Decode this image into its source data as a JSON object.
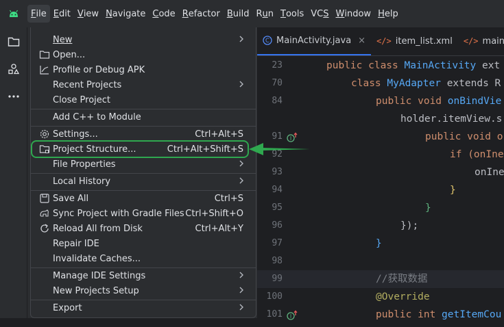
{
  "menubar": {
    "items": [
      "File",
      "Edit",
      "View",
      "Navigate",
      "Code",
      "Refactor",
      "Build",
      "Run",
      "Tools",
      "VCS",
      "Window",
      "Help"
    ],
    "mnemonics": [
      "F",
      "E",
      "V",
      "N",
      "C",
      "R",
      "B",
      "u",
      "T",
      "S",
      "W",
      "H"
    ]
  },
  "tabs": [
    {
      "label": "MainActivity.java",
      "icon": "class-icon",
      "close": "×"
    },
    {
      "label": "item_list.xml",
      "icon": "xml-icon"
    },
    {
      "label": "main_ac",
      "icon": "xml-icon"
    }
  ],
  "file_menu": {
    "new": "New",
    "open": "Open...",
    "profile": "Profile or Debug APK",
    "recent": "Recent Projects",
    "close": "Close Project",
    "add_cpp": "Add C++ to Module",
    "settings": "Settings...",
    "settings_sc": "Ctrl+Alt+S",
    "project_structure": "Project Structure...",
    "project_structure_sc": "Ctrl+Alt+Shift+S",
    "file_props": "File Properties",
    "local_history": "Local History",
    "save_all": "Save All",
    "save_all_sc": "Ctrl+S",
    "sync": "Sync Project with Gradle Files",
    "sync_sc": "Ctrl+Shift+O",
    "reload": "Reload All from Disk",
    "reload_sc": "Ctrl+Alt+Y",
    "repair": "Repair IDE",
    "invalidate": "Invalidate Caches...",
    "manage": "Manage IDE Settings",
    "new_setup": "New Projects Setup",
    "export": "Export"
  },
  "code": {
    "line_numbers": [
      "23",
      "70",
      "84",
      "",
      "91",
      "92",
      "93",
      "94",
      "95",
      "96",
      "97",
      "98",
      "99",
      "100",
      "101"
    ],
    "l23_a": "public class ",
    "l23_b": "MainActivity",
    "l23_c": " ext",
    "l70_a": "class ",
    "l70_b": "MyAdapter",
    "l70_c": " extends R",
    "l84_a": "public void ",
    "l84_b": "onBindVie",
    "l85": "holder.itemView.s",
    "l91_a": "public void o",
    "l92_a": "if (onIne",
    "l93": "onIne",
    "l94": "}",
    "l95": "}",
    "l96": "});",
    "l97": "}",
    "l99": "//获取数据",
    "l100": "@Override",
    "l101_a": "public int ",
    "l101_b": "getItemCou"
  },
  "colors": {
    "accent": "#3574f0",
    "annotation": "#2fa84f"
  }
}
